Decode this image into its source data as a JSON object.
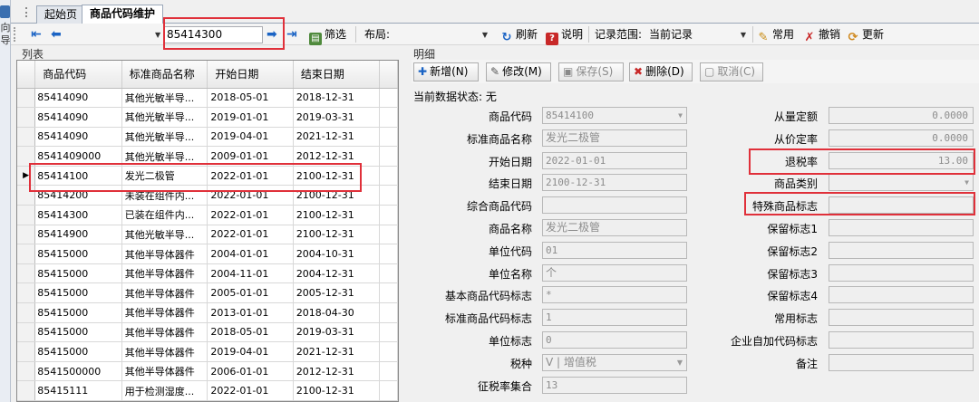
{
  "left_strip": {
    "chars": [
      "向",
      "导"
    ]
  },
  "tabs": [
    {
      "label": "起始页"
    },
    {
      "label": "商品代码维护"
    }
  ],
  "toolbar": {
    "search_value": "85414300",
    "filter_label": "筛选",
    "layout_label": "布局:",
    "refresh_label": "刷新",
    "help_label": "说明",
    "range_label": "记录范围:",
    "range_value": "当前记录",
    "common_label": "常用",
    "revoke_label": "撤销",
    "update_label": "更新"
  },
  "list": {
    "title": "列表",
    "columns": [
      "商品代码",
      "标准商品名称",
      "开始日期",
      "结束日期"
    ],
    "rows": [
      [
        "85414090",
        "其他光敏半导...",
        "2018-05-01",
        "2018-12-31"
      ],
      [
        "85414090",
        "其他光敏半导...",
        "2019-01-01",
        "2019-03-31"
      ],
      [
        "85414090",
        "其他光敏半导...",
        "2019-04-01",
        "2021-12-31"
      ],
      [
        "8541409000",
        "其他光敏半导...",
        "2009-01-01",
        "2012-12-31"
      ],
      [
        "85414100",
        "发光二极管",
        "2022-01-01",
        "2100-12-31"
      ],
      [
        "85414200",
        "未装在组件内...",
        "2022-01-01",
        "2100-12-31"
      ],
      [
        "85414300",
        "已装在组件内...",
        "2022-01-01",
        "2100-12-31"
      ],
      [
        "85414900",
        "其他光敏半导...",
        "2022-01-01",
        "2100-12-31"
      ],
      [
        "85415000",
        "其他半导体器件",
        "2004-01-01",
        "2004-10-31"
      ],
      [
        "85415000",
        "其他半导体器件",
        "2004-11-01",
        "2004-12-31"
      ],
      [
        "85415000",
        "其他半导体器件",
        "2005-01-01",
        "2005-12-31"
      ],
      [
        "85415000",
        "其他半导体器件",
        "2013-01-01",
        "2018-04-30"
      ],
      [
        "85415000",
        "其他半导体器件",
        "2018-05-01",
        "2019-03-31"
      ],
      [
        "85415000",
        "其他半导体器件",
        "2019-04-01",
        "2021-12-31"
      ],
      [
        "8541500000",
        "其他半导体器件",
        "2006-01-01",
        "2012-12-31"
      ],
      [
        "85415111",
        "用于检测湿度...",
        "2022-01-01",
        "2100-12-31"
      ]
    ],
    "selected_row": 4
  },
  "detail": {
    "title": "明细",
    "buttons": {
      "add": "新增(N)",
      "edit": "修改(M)",
      "save": "保存(S)",
      "delete": "删除(D)",
      "cancel": "取消(C)"
    },
    "status": "当前数据状态: 无",
    "left_fields": [
      {
        "label": "商品代码",
        "value": "85414100"
      },
      {
        "label": "标准商品名称",
        "value": "发光二极管"
      },
      {
        "label": "开始日期",
        "value": "2022-01-01"
      },
      {
        "label": "结束日期",
        "value": "2100-12-31"
      },
      {
        "label": "综合商品代码",
        "value": ""
      },
      {
        "label": "商品名称",
        "value": "发光二极管"
      },
      {
        "label": "单位代码",
        "value": "01"
      },
      {
        "label": "单位名称",
        "value": "个"
      },
      {
        "label": "基本商品代码标志",
        "value": "*"
      },
      {
        "label": "标准商品代码标志",
        "value": "1"
      },
      {
        "label": "单位标志",
        "value": "0"
      },
      {
        "label": "税种",
        "value": "V | 增值税"
      },
      {
        "label": "征税率集合",
        "value": "13"
      }
    ],
    "right_fields": [
      {
        "label": "从量定额",
        "value": "0.0000"
      },
      {
        "label": "从价定率",
        "value": "0.0000"
      },
      {
        "label": "退税率",
        "value": "13.00"
      },
      {
        "label": "商品类别",
        "value": ""
      },
      {
        "label": "特殊商品标志",
        "value": ""
      },
      {
        "label": "保留标志1",
        "value": ""
      },
      {
        "label": "保留标志2",
        "value": ""
      },
      {
        "label": "保留标志3",
        "value": ""
      },
      {
        "label": "保留标志4",
        "value": ""
      },
      {
        "label": "常用标志",
        "value": ""
      },
      {
        "label": "企业自加代码标志",
        "value": ""
      },
      {
        "label": "备注",
        "value": ""
      }
    ]
  },
  "colors": {
    "highlight": "#e0303a",
    "arrow": "#1a63c4"
  }
}
